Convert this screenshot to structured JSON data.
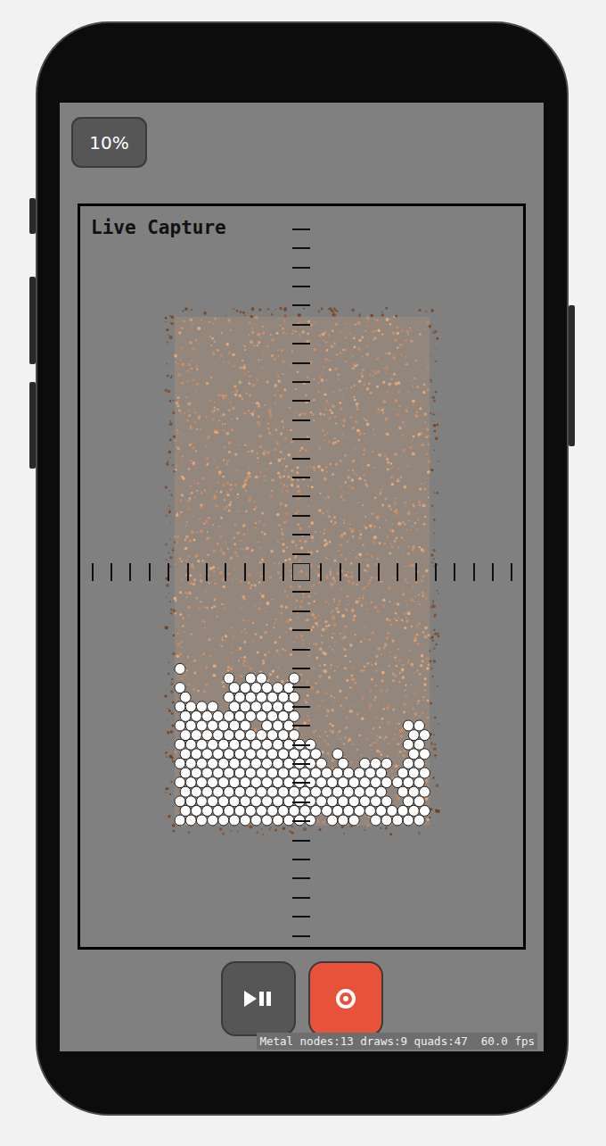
{
  "zoom_button": {
    "label": "10%"
  },
  "capture": {
    "title": "Live Capture"
  },
  "stats_overlay": {
    "text": "Metal nodes:13 draws:9 quads:47  60.0 fps"
  }
}
